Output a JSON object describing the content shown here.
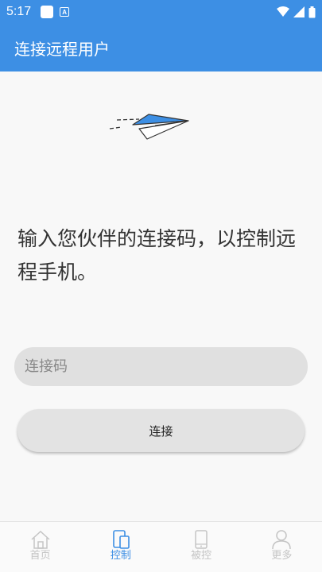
{
  "status_bar": {
    "time": "5:17"
  },
  "app_bar": {
    "title": "连接远程用户"
  },
  "main": {
    "prompt": "输入您伙伴的连接码，以控制远程手机。",
    "code_input": {
      "placeholder": "连接码",
      "value": ""
    },
    "connect_label": "连接"
  },
  "bottom_nav": {
    "items": [
      {
        "label": "首页",
        "icon": "home-icon",
        "active": false
      },
      {
        "label": "控制",
        "icon": "control-devices-icon",
        "active": true
      },
      {
        "label": "被控",
        "icon": "phone-icon",
        "active": false
      },
      {
        "label": "更多",
        "icon": "person-icon",
        "active": false
      }
    ]
  },
  "colors": {
    "primary": "#3d8fe4",
    "inactive": "#c4c4c4",
    "input_bg": "#e0e0e0"
  }
}
